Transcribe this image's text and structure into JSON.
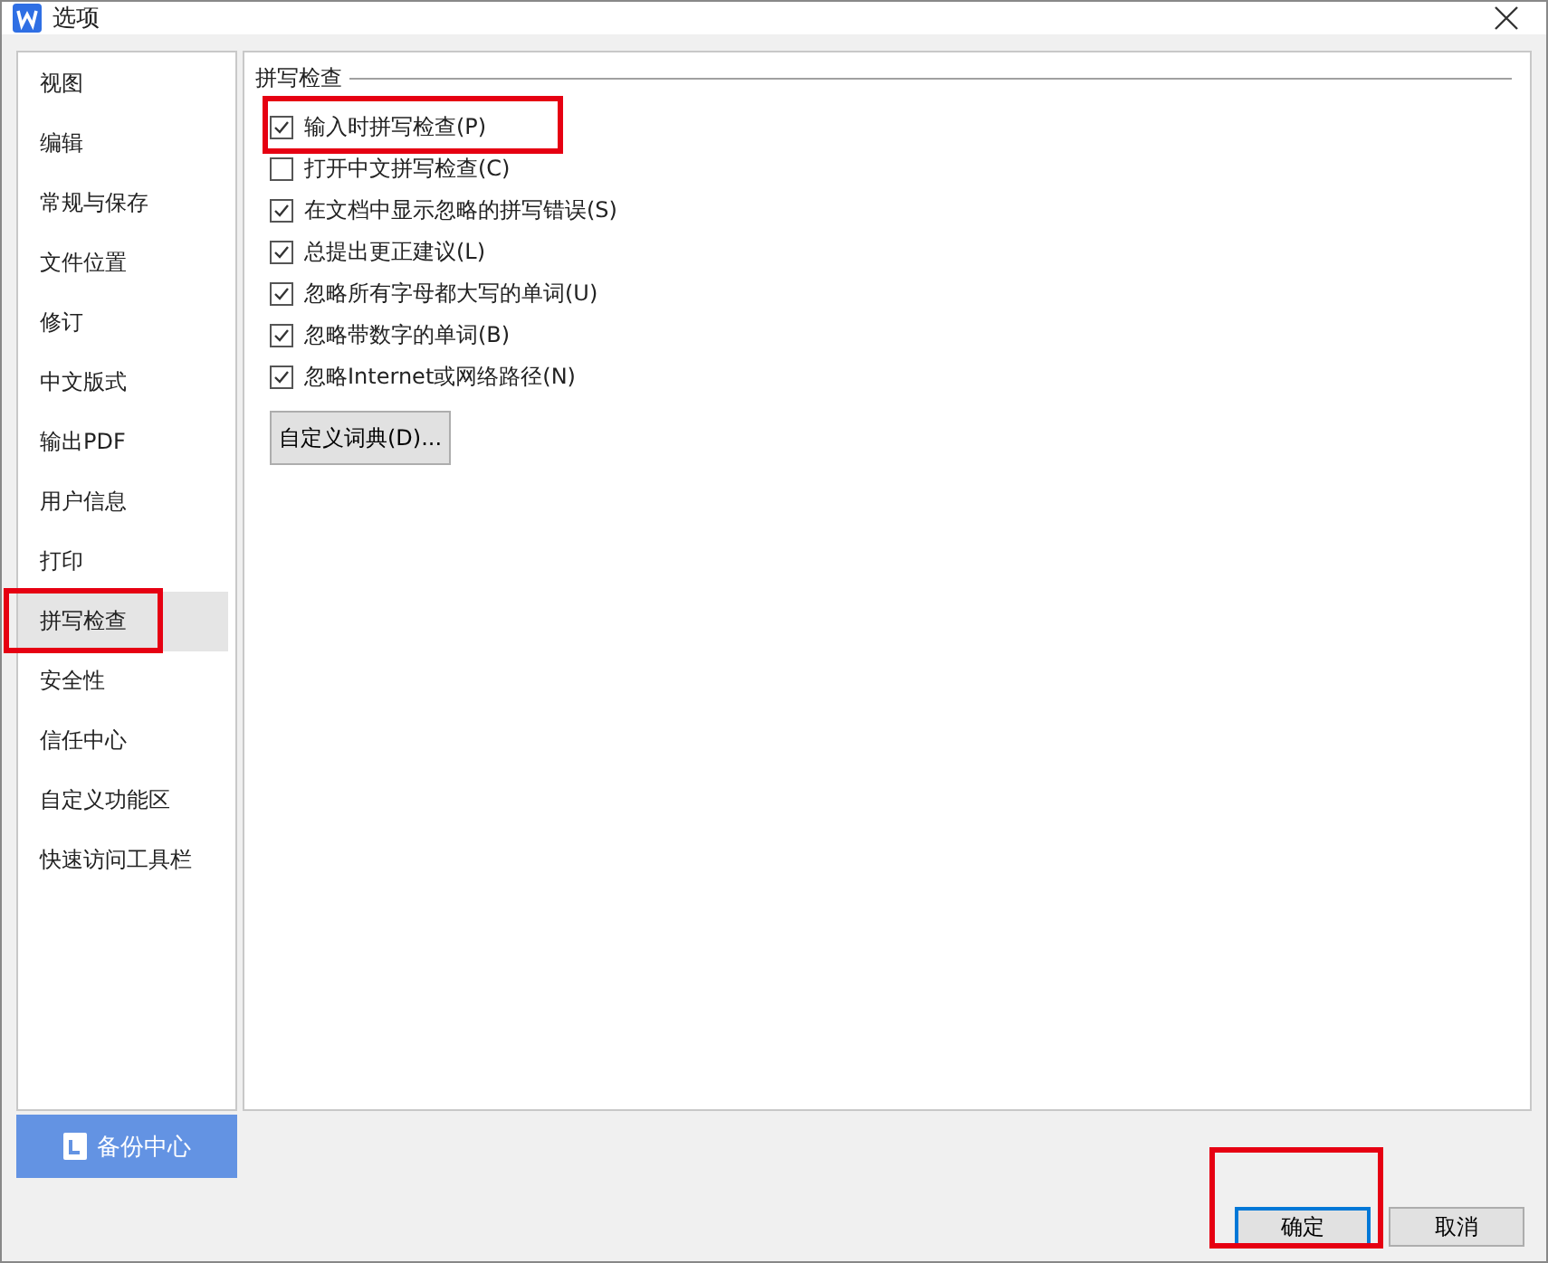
{
  "window": {
    "title": "选项"
  },
  "sidebar": {
    "items": [
      {
        "label": "视图",
        "selected": false,
        "highlighted": false
      },
      {
        "label": "编辑",
        "selected": false,
        "highlighted": false
      },
      {
        "label": "常规与保存",
        "selected": false,
        "highlighted": false
      },
      {
        "label": "文件位置",
        "selected": false,
        "highlighted": false
      },
      {
        "label": "修订",
        "selected": false,
        "highlighted": false
      },
      {
        "label": "中文版式",
        "selected": false,
        "highlighted": false
      },
      {
        "label": "输出PDF",
        "selected": false,
        "highlighted": false
      },
      {
        "label": "用户信息",
        "selected": false,
        "highlighted": false
      },
      {
        "label": "打印",
        "selected": false,
        "highlighted": false
      },
      {
        "label": "拼写检查",
        "selected": true,
        "highlighted": true
      },
      {
        "label": "安全性",
        "selected": false,
        "highlighted": false
      },
      {
        "label": "信任中心",
        "selected": false,
        "highlighted": false
      },
      {
        "label": "自定义功能区",
        "selected": false,
        "highlighted": false
      },
      {
        "label": "快速访问工具栏",
        "selected": false,
        "highlighted": false
      }
    ],
    "backup_button": "备份中心"
  },
  "section": {
    "title": "拼写检查",
    "options": [
      {
        "label": "输入时拼写检查(P)",
        "checked": true,
        "highlighted": true
      },
      {
        "label": "打开中文拼写检查(C)",
        "checked": false,
        "highlighted": false
      },
      {
        "label": "在文档中显示忽略的拼写错误(S)",
        "checked": true,
        "highlighted": false
      },
      {
        "label": "总提出更正建议(L)",
        "checked": true,
        "highlighted": false
      },
      {
        "label": "忽略所有字母都大写的单词(U)",
        "checked": true,
        "highlighted": false
      },
      {
        "label": "忽略带数字的单词(B)",
        "checked": true,
        "highlighted": false
      },
      {
        "label": "忽略Internet或网络路径(N)",
        "checked": true,
        "highlighted": false
      }
    ],
    "dictionary_button": "自定义词典(D)..."
  },
  "buttons": [
    {
      "label": "确定",
      "kind": "primary",
      "highlighted": true
    },
    {
      "label": "取消",
      "kind": "normal",
      "highlighted": false
    }
  ]
}
